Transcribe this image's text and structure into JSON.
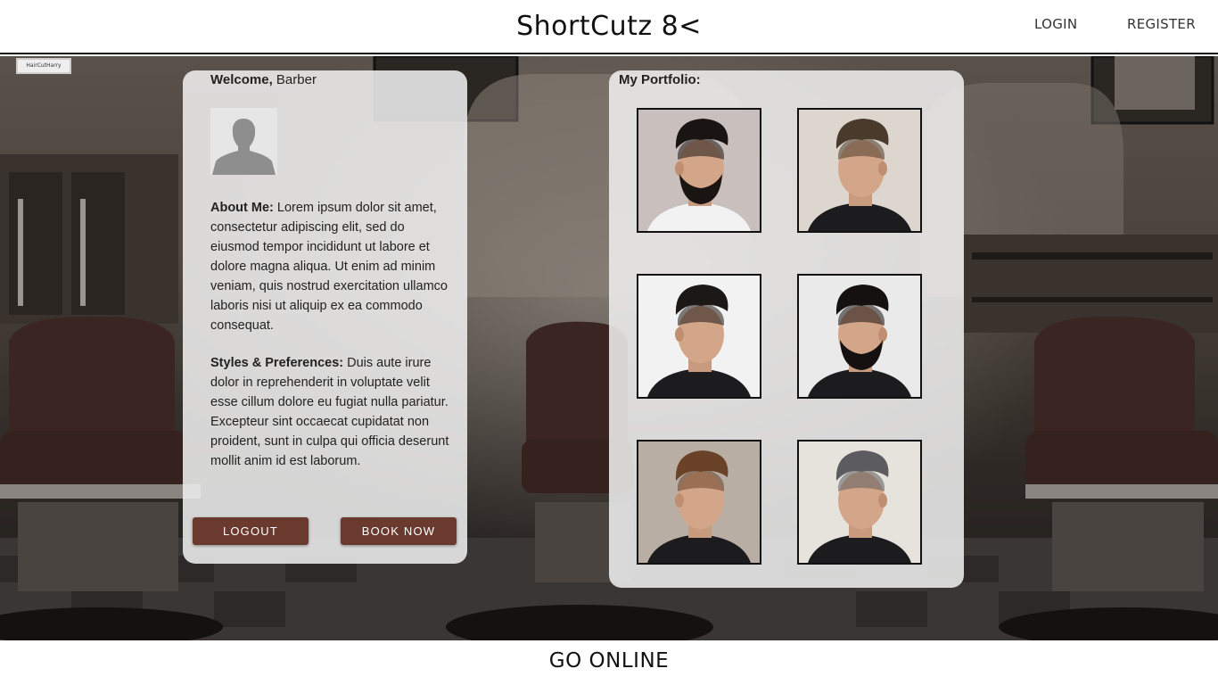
{
  "header": {
    "brand": "ShortCutz 8<",
    "login_label": "LOGIN",
    "register_label": "REGISTER"
  },
  "profile": {
    "welcome_prefix": "Welcome,",
    "welcome_name": "Barber",
    "about_label": "About Me:",
    "about_text": "Lorem ipsum dolor sit amet, consectetur adipiscing elit, sed do eiusmod tempor incididunt ut labore et dolore magna aliqua. Ut enim ad minim veniam, quis nostrud exercitation ullamco laboris nisi ut aliquip ex ea commodo consequat.",
    "styles_label": "Styles & Preferences:",
    "styles_text": "Duis aute irure dolor in reprehenderit in voluptate velit esse cillum dolore eu fugiat nulla pariatur. Excepteur sint occaecat cupidatat non proident, sunt in culpa qui officia deserunt mollit anim id est laborum.",
    "logout_label": "LOGOUT",
    "book_label": "BOOK NOW"
  },
  "portfolio": {
    "title": "My Portfolio:",
    "items": [
      {
        "name": "pompadour-beard-fade",
        "bg": "#c9c0bd",
        "hair": "#1a1412",
        "beard": true
      },
      {
        "name": "textured-quiff",
        "bg": "#dcd6cf",
        "hair": "#4a3a2c",
        "beard": false
      },
      {
        "name": "spiky-fade",
        "bg": "#f2f2f2",
        "hair": "#1c1816",
        "beard": false
      },
      {
        "name": "curly-fade-beard",
        "bg": "#eaeaea",
        "hair": "#141110",
        "beard": true
      },
      {
        "name": "textured-crop-fade",
        "bg": "#b9aea4",
        "hair": "#6a4228",
        "beard": false
      },
      {
        "name": "grey-quiff-fade",
        "bg": "#e6e2dc",
        "hair": "#5c5c60",
        "beard": false
      }
    ]
  },
  "background": {
    "sign_text": "HairCutHarry"
  },
  "footer": {
    "go_online_label": "GO ONLINE"
  },
  "colors": {
    "button": "#6b3a2f",
    "panel": "#eeeeee"
  }
}
